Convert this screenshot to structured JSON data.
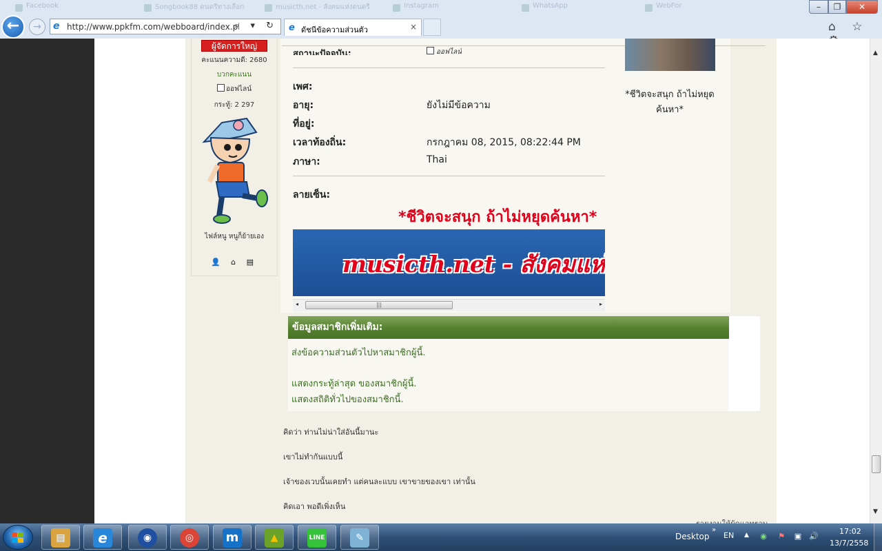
{
  "browser": {
    "background_tabs": [
      "Facebook",
      "Songbook88 ดนตรีทางเลือก",
      "musicth.net - สังคมแห่งดนตรี",
      "Instagram",
      "WhatsApp",
      "WebFor"
    ],
    "url": "http://www.ppkfm.com/webboard/index.php?ac",
    "active_tab_title": "ดัชนีข้อความส่วนตัว",
    "close_tab_glyph": "×",
    "window_controls": {
      "minimize": "–",
      "maximize": "❐",
      "close": "✕"
    },
    "back_glyph": "←",
    "forward_glyph": "→",
    "address_tools": "⌕ ▾ ↻",
    "command_icons": "⌂ ☆ ⚙"
  },
  "sidebar": {
    "role": "ผู้จัดการใหญ่",
    "karma": "คะแนนความดี: 2680",
    "applaud": "บวกคะแนน",
    "status": "ออฟไลน์",
    "posts": "กระทู้: 2 297",
    "blurb": "ไฟล์หนู หนูก็ย้ายเอง",
    "icons": "👤 ⌂ ▤"
  },
  "profile": {
    "status_label": "สถานะปัจจุบัน:",
    "status_value": "ออฟไลน์",
    "fields": [
      {
        "label": "เพศ:",
        "value": ""
      },
      {
        "label": "อายุ:",
        "value": "ยังไม่มีข้อความ"
      },
      {
        "label": "ที่อยู่:",
        "value": ""
      },
      {
        "label": "เวลาท้องถิ่น:",
        "value": "กรกฎาคม 08, 2015, 08:22:44 PM"
      },
      {
        "label": "ภาษา:",
        "value": "Thai"
      }
    ],
    "signature_label": "ลายเซ็น:",
    "signature_text": "*ชีวิตจะสนุก ถ้าไม่หยุดค้นหา*",
    "banner_text": "musicth.net - สังคมแห่งดนตรี",
    "hscroll_left": "◂",
    "hscroll_right": "▸",
    "hscroll_grip": "|||"
  },
  "right_panel": {
    "quote": "*ชีวิตจะสนุก ถ้าไม่หยุดค้นหา*"
  },
  "more_info": {
    "header": "ข้อมูลสมาชิกเพิ่มเติม:",
    "links": [
      "ส่งข้อความส่วนตัวไปหาสมาชิกผู้นี้.",
      "แสดงกระทู้ล่าสุด ของสมาชิกผู้นี้.",
      "แสดงสถิติทั่วไปของสมาชิกนี้."
    ]
  },
  "post_lines": [
    "คิดว่า ท่านไม่น่าใส่อันนี้มานะ",
    "เขาไม่ทำกันแบบนี้",
    "เจ้าของเวบนั้นเคยทำ แต่คนละแบบ เขาขายของเขา เท่านั้น",
    "คิดเอา พอดีเพิ่งเห็น"
  ],
  "bottom_cut_text": "รายงานให้ผู้ดูแลทราบ",
  "page_scroll": {
    "up": "▲",
    "down": "▼"
  },
  "taskbar": {
    "apps": [
      {
        "name": "file-explorer",
        "glyph": "▤",
        "color": "#d9a441"
      },
      {
        "name": "internet-explorer",
        "glyph": "e",
        "color": "#2a86d8"
      },
      {
        "name": "firefox",
        "glyph": "◉",
        "color": "#1f4fa0"
      },
      {
        "name": "chrome",
        "glyph": "◎",
        "color": "#db4437"
      },
      {
        "name": "maxthon",
        "glyph": "m",
        "color": "#1672c8"
      },
      {
        "name": "navigator",
        "glyph": "▲",
        "color": "#6aa22a"
      },
      {
        "name": "line",
        "glyph": "LINE",
        "color": "#35c13a"
      },
      {
        "name": "notepad",
        "glyph": "✎",
        "color": "#7fb3d6"
      }
    ],
    "desktop_label": "Desktop",
    "chevron": "»",
    "language": "EN",
    "tray_up": "▲",
    "tray_icons": [
      "◉",
      "⚑",
      "▣",
      "🔊"
    ],
    "time": "17:02",
    "date": "13/7/2558"
  },
  "colors": {
    "accent_green": "#55802e",
    "role_red": "#d71f1f",
    "signature_red": "#e0001b"
  }
}
